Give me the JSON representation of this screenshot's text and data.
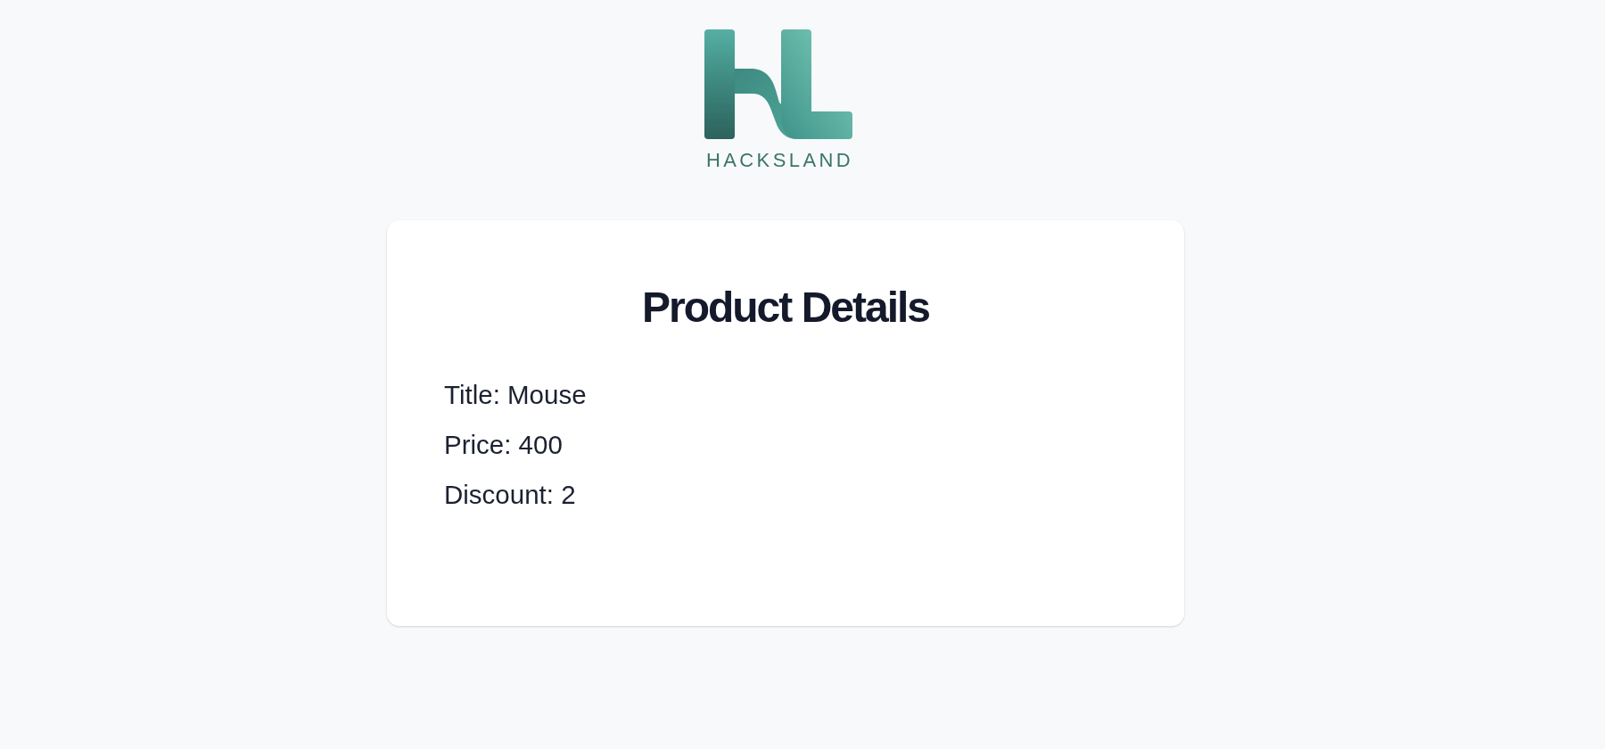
{
  "logo": {
    "wordmark": "HACKSLAND"
  },
  "card": {
    "title": "Product Details",
    "lines": [
      "Title: Mouse",
      "Price: 400",
      "Discount: 2"
    ]
  }
}
